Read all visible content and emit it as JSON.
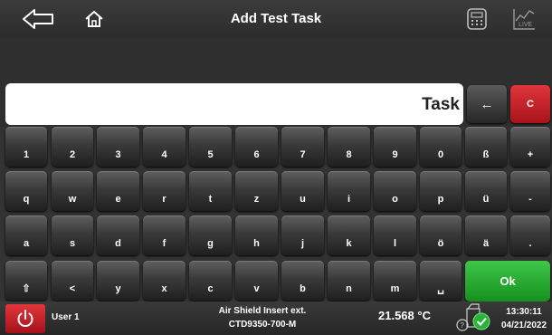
{
  "header": {
    "title": "Add Test Task"
  },
  "input": {
    "value": "Task",
    "backspace_label": "←",
    "clear_label": "C"
  },
  "keyboard": {
    "rows": [
      [
        "1",
        "2",
        "3",
        "4",
        "5",
        "6",
        "7",
        "8",
        "9",
        "0",
        "ß",
        "+"
      ],
      [
        "q",
        "w",
        "e",
        "r",
        "t",
        "z",
        "u",
        "i",
        "o",
        "p",
        "ü",
        "-"
      ],
      [
        "a",
        "s",
        "d",
        "f",
        "g",
        "h",
        "j",
        "k",
        "l",
        "ö",
        "ä",
        "."
      ],
      [
        "⇧",
        "<",
        "y",
        "x",
        "c",
        "v",
        "b",
        "n",
        "m",
        "␣"
      ]
    ],
    "ok_label": "Ok"
  },
  "status_bar": {
    "user": "User 1",
    "device_line1": "Air Shield Insert ext.",
    "device_line2": "CTD9350-700-M",
    "temperature": "21.568 °C",
    "time": "13:30:11",
    "date": "04/21/2022"
  },
  "colors": {
    "accent_red": "#c8242b",
    "accent_green": "#2ab437",
    "background": "#2e2e2e"
  },
  "icons": {
    "back": "back-arrow-icon",
    "home": "home-icon",
    "calculator": "calculator-icon",
    "live": "live-chart-icon",
    "power": "power-icon",
    "sensor": "sensor-status-icon"
  }
}
